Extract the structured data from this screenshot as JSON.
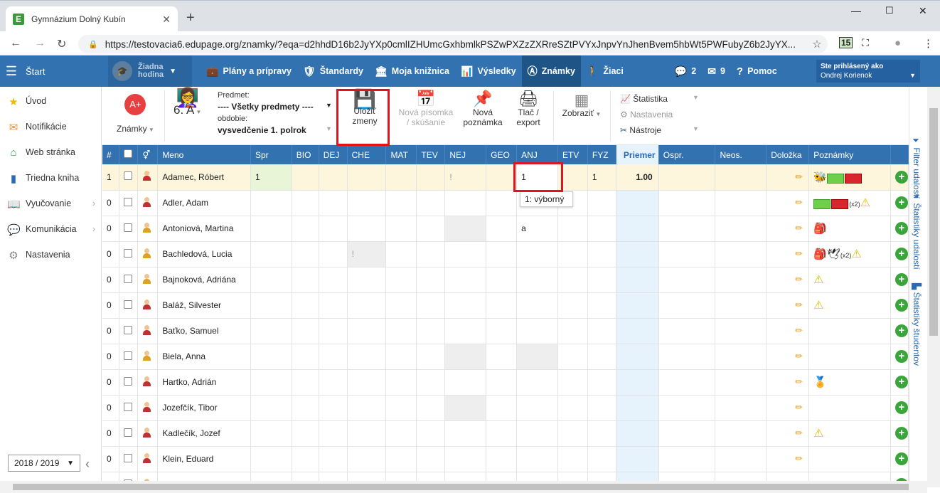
{
  "browser": {
    "tab_title": "Gymnázium Dolný Kubín",
    "url": "https://testovacia6.edupage.org/znamky/?eqa=d2hhdD16b2JyYXp0cmlIZHUmcGxhbmlkPSZwPXZzZXRreSZtPVYxJnpvYnJhenBvem5hbWt5PWFubyZ6b2JyYX...",
    "ext_badge": "15"
  },
  "header": {
    "start_label": "Štart",
    "hodina_label_1": "Žiadna",
    "hodina_label_2": "hodina",
    "nav": [
      {
        "label": "Plány a prípravy",
        "icon": "briefcase-icon"
      },
      {
        "label": "Štandardy",
        "icon": "shield-icon"
      },
      {
        "label": "Moja knižnica",
        "icon": "library-icon"
      },
      {
        "label": "Výsledky",
        "icon": "bar-chart-icon"
      },
      {
        "label": "Známky",
        "icon": "grades-icon"
      },
      {
        "label": "Žiaci",
        "icon": "students-icon"
      }
    ],
    "messages_count": "2",
    "mail_count": "9",
    "help_label": "Pomoc",
    "signed_as_label": "Ste prihlásený ako",
    "user_name": "Ondrej Korienok"
  },
  "sidebar": {
    "items": [
      {
        "label": "Úvod",
        "icon": "star-icon"
      },
      {
        "label": "Notifikácie",
        "icon": "envelope-icon"
      },
      {
        "label": "Web stránka",
        "icon": "house-icon"
      },
      {
        "label": "Triedna kniha",
        "icon": "book-icon"
      },
      {
        "label": "Vyučovanie",
        "icon": "open-book-icon"
      },
      {
        "label": "Komunikácia",
        "icon": "chat-icon"
      },
      {
        "label": "Nastavenia",
        "icon": "gear-icon"
      }
    ],
    "year": "2018 / 2019"
  },
  "toolbar": {
    "znamky_label": "Známky",
    "class_label": "6. A",
    "predmet_caption": "Predmet:",
    "predmet_value": "---- Všetky predmety ----",
    "obdobie_caption": "obdobie:",
    "obdobie_value": "vysvedčenie 1. polrok",
    "save_1": "Uložiť",
    "save_2": "zmeny",
    "new_test_1": "Nová písomka",
    "new_test_2": "/ skúšanie",
    "new_note_1": "Nová",
    "new_note_2": "poznámka",
    "print_1": "Tlač /",
    "print_2": "export",
    "view_label": "Zobraziť",
    "stats_label": "Štatistika",
    "settings_label": "Nastavenia",
    "tools_label": "Nástroje"
  },
  "rightbar": {
    "filter": "Filter udalostí",
    "event_stats": "Štatistiky udalostí",
    "student_stats": "Štatistiky študentov"
  },
  "grid": {
    "columns": [
      "#",
      "",
      "",
      "Meno",
      "Spr",
      "BIO",
      "DEJ",
      "CHE",
      "MAT",
      "TEV",
      "NEJ",
      "GEO",
      "ANJ",
      "ETV",
      "FYZ",
      "Priemer",
      "Ospr.",
      "Neos.",
      "Doložka",
      "Poznámky"
    ],
    "rows": [
      {
        "num": "1",
        "name": "Adamec, Róbert",
        "spr": "1",
        "nej": "!",
        "anj": "1",
        "fyz": "1",
        "avg": "1.00",
        "gender": "m"
      },
      {
        "num": "0",
        "name": "Adler, Adam",
        "gender": "m"
      },
      {
        "num": "0",
        "name": "Antoniová, Martina",
        "anj": "a",
        "gender": "f"
      },
      {
        "num": "0",
        "name": "Bachledová, Lucia",
        "che": "!",
        "gender": "f"
      },
      {
        "num": "0",
        "name": "Bajnoková, Adriána",
        "gender": "f"
      },
      {
        "num": "0",
        "name": "Baláž, Silvester",
        "gender": "m"
      },
      {
        "num": "0",
        "name": "Baťko, Samuel",
        "gender": "m"
      },
      {
        "num": "0",
        "name": "Biela, Anna",
        "gender": "f"
      },
      {
        "num": "0",
        "name": "Hartko, Adrián",
        "gender": "m"
      },
      {
        "num": "0",
        "name": "Jozefčík, Tibor",
        "gender": "m"
      },
      {
        "num": "0",
        "name": "Kadlečík, Jozef",
        "gender": "m"
      },
      {
        "num": "0",
        "name": "Klein, Eduard",
        "gender": "m"
      },
      {
        "num": "0",
        "name": "",
        "gender": "f"
      }
    ],
    "note_x2": "(x2)",
    "dropdown_option": "1: výborný"
  }
}
